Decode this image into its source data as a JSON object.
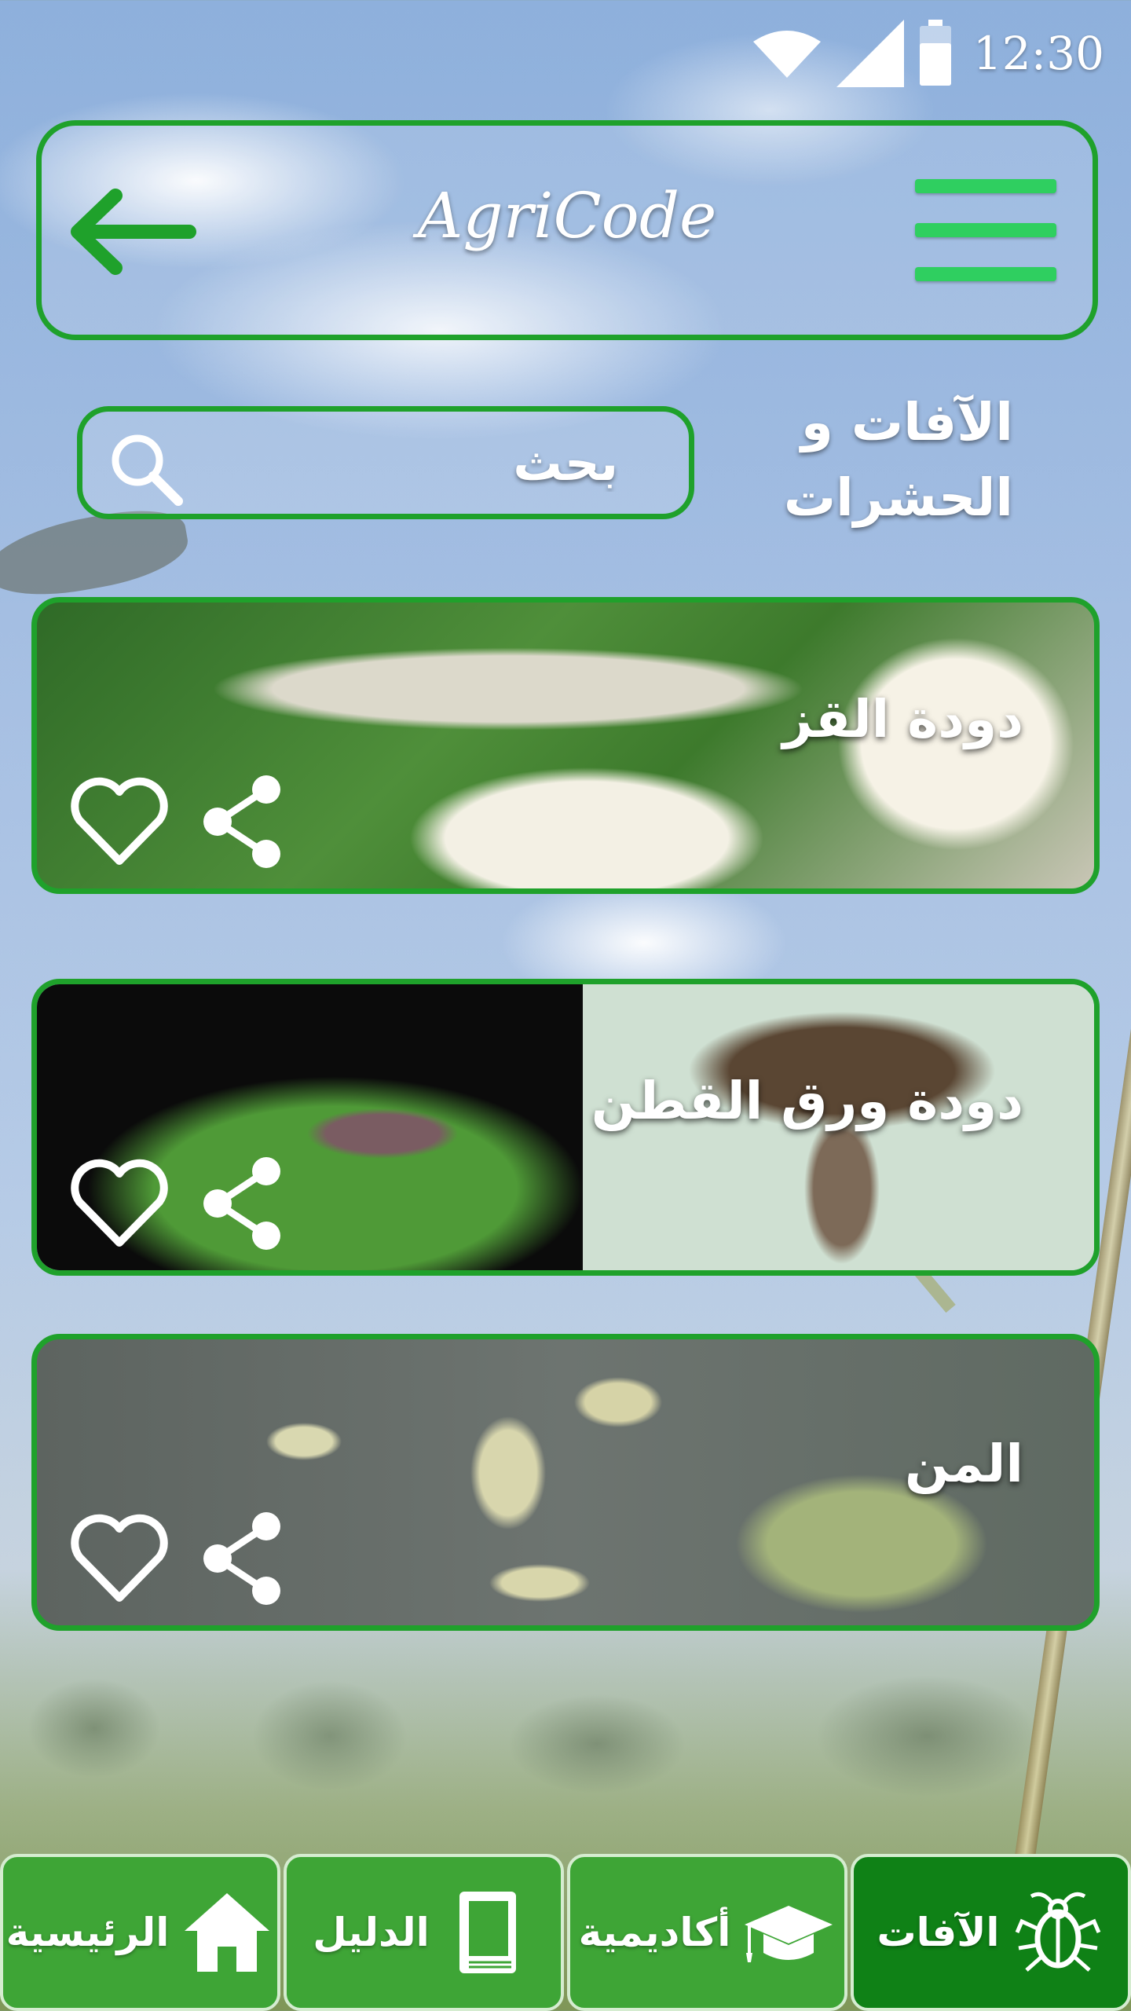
{
  "status_bar": {
    "time": "12:30",
    "icons": [
      "wifi-icon",
      "signal-icon",
      "battery-icon"
    ]
  },
  "header": {
    "title": "AgriCode",
    "back_icon": "arrow-left-icon",
    "menu_icon": "hamburger-menu-icon"
  },
  "section": {
    "title": "الآفات و الحشرات"
  },
  "search": {
    "placeholder": "بحث",
    "icon": "search-icon"
  },
  "pests": [
    {
      "name": "دودة القز"
    },
    {
      "name": "دودة ورق القطن"
    },
    {
      "name": "المن"
    }
  ],
  "bottom_nav": {
    "items": [
      {
        "label": "الآفات",
        "icon": "bug-icon",
        "active": true
      },
      {
        "label": "أكاديمية",
        "icon": "graduation-cap-icon",
        "active": false
      },
      {
        "label": "الدليل",
        "icon": "book-icon",
        "active": false
      },
      {
        "label": "الرئيسية",
        "icon": "home-icon",
        "active": false
      }
    ]
  },
  "colors": {
    "accent": "#1fa12b",
    "menu_bar": "#2fcf60",
    "nav_bg": "#3ea536",
    "nav_active": "#0f8116"
  }
}
